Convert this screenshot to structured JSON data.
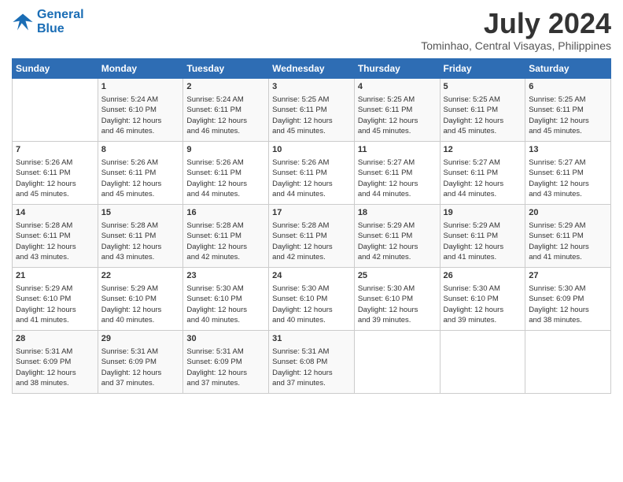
{
  "logo": {
    "line1": "General",
    "line2": "Blue"
  },
  "title": "July 2024",
  "location": "Tominhao, Central Visayas, Philippines",
  "days_header": [
    "Sunday",
    "Monday",
    "Tuesday",
    "Wednesday",
    "Thursday",
    "Friday",
    "Saturday"
  ],
  "weeks": [
    [
      {
        "day": "",
        "lines": []
      },
      {
        "day": "1",
        "lines": [
          "Sunrise: 5:24 AM",
          "Sunset: 6:10 PM",
          "Daylight: 12 hours",
          "and 46 minutes."
        ]
      },
      {
        "day": "2",
        "lines": [
          "Sunrise: 5:24 AM",
          "Sunset: 6:11 PM",
          "Daylight: 12 hours",
          "and 46 minutes."
        ]
      },
      {
        "day": "3",
        "lines": [
          "Sunrise: 5:25 AM",
          "Sunset: 6:11 PM",
          "Daylight: 12 hours",
          "and 45 minutes."
        ]
      },
      {
        "day": "4",
        "lines": [
          "Sunrise: 5:25 AM",
          "Sunset: 6:11 PM",
          "Daylight: 12 hours",
          "and 45 minutes."
        ]
      },
      {
        "day": "5",
        "lines": [
          "Sunrise: 5:25 AM",
          "Sunset: 6:11 PM",
          "Daylight: 12 hours",
          "and 45 minutes."
        ]
      },
      {
        "day": "6",
        "lines": [
          "Sunrise: 5:25 AM",
          "Sunset: 6:11 PM",
          "Daylight: 12 hours",
          "and 45 minutes."
        ]
      }
    ],
    [
      {
        "day": "7",
        "lines": [
          "Sunrise: 5:26 AM",
          "Sunset: 6:11 PM",
          "Daylight: 12 hours",
          "and 45 minutes."
        ]
      },
      {
        "day": "8",
        "lines": [
          "Sunrise: 5:26 AM",
          "Sunset: 6:11 PM",
          "Daylight: 12 hours",
          "and 45 minutes."
        ]
      },
      {
        "day": "9",
        "lines": [
          "Sunrise: 5:26 AM",
          "Sunset: 6:11 PM",
          "Daylight: 12 hours",
          "and 44 minutes."
        ]
      },
      {
        "day": "10",
        "lines": [
          "Sunrise: 5:26 AM",
          "Sunset: 6:11 PM",
          "Daylight: 12 hours",
          "and 44 minutes."
        ]
      },
      {
        "day": "11",
        "lines": [
          "Sunrise: 5:27 AM",
          "Sunset: 6:11 PM",
          "Daylight: 12 hours",
          "and 44 minutes."
        ]
      },
      {
        "day": "12",
        "lines": [
          "Sunrise: 5:27 AM",
          "Sunset: 6:11 PM",
          "Daylight: 12 hours",
          "and 44 minutes."
        ]
      },
      {
        "day": "13",
        "lines": [
          "Sunrise: 5:27 AM",
          "Sunset: 6:11 PM",
          "Daylight: 12 hours",
          "and 43 minutes."
        ]
      }
    ],
    [
      {
        "day": "14",
        "lines": [
          "Sunrise: 5:28 AM",
          "Sunset: 6:11 PM",
          "Daylight: 12 hours",
          "and 43 minutes."
        ]
      },
      {
        "day": "15",
        "lines": [
          "Sunrise: 5:28 AM",
          "Sunset: 6:11 PM",
          "Daylight: 12 hours",
          "and 43 minutes."
        ]
      },
      {
        "day": "16",
        "lines": [
          "Sunrise: 5:28 AM",
          "Sunset: 6:11 PM",
          "Daylight: 12 hours",
          "and 42 minutes."
        ]
      },
      {
        "day": "17",
        "lines": [
          "Sunrise: 5:28 AM",
          "Sunset: 6:11 PM",
          "Daylight: 12 hours",
          "and 42 minutes."
        ]
      },
      {
        "day": "18",
        "lines": [
          "Sunrise: 5:29 AM",
          "Sunset: 6:11 PM",
          "Daylight: 12 hours",
          "and 42 minutes."
        ]
      },
      {
        "day": "19",
        "lines": [
          "Sunrise: 5:29 AM",
          "Sunset: 6:11 PM",
          "Daylight: 12 hours",
          "and 41 minutes."
        ]
      },
      {
        "day": "20",
        "lines": [
          "Sunrise: 5:29 AM",
          "Sunset: 6:11 PM",
          "Daylight: 12 hours",
          "and 41 minutes."
        ]
      }
    ],
    [
      {
        "day": "21",
        "lines": [
          "Sunrise: 5:29 AM",
          "Sunset: 6:10 PM",
          "Daylight: 12 hours",
          "and 41 minutes."
        ]
      },
      {
        "day": "22",
        "lines": [
          "Sunrise: 5:29 AM",
          "Sunset: 6:10 PM",
          "Daylight: 12 hours",
          "and 40 minutes."
        ]
      },
      {
        "day": "23",
        "lines": [
          "Sunrise: 5:30 AM",
          "Sunset: 6:10 PM",
          "Daylight: 12 hours",
          "and 40 minutes."
        ]
      },
      {
        "day": "24",
        "lines": [
          "Sunrise: 5:30 AM",
          "Sunset: 6:10 PM",
          "Daylight: 12 hours",
          "and 40 minutes."
        ]
      },
      {
        "day": "25",
        "lines": [
          "Sunrise: 5:30 AM",
          "Sunset: 6:10 PM",
          "Daylight: 12 hours",
          "and 39 minutes."
        ]
      },
      {
        "day": "26",
        "lines": [
          "Sunrise: 5:30 AM",
          "Sunset: 6:10 PM",
          "Daylight: 12 hours",
          "and 39 minutes."
        ]
      },
      {
        "day": "27",
        "lines": [
          "Sunrise: 5:30 AM",
          "Sunset: 6:09 PM",
          "Daylight: 12 hours",
          "and 38 minutes."
        ]
      }
    ],
    [
      {
        "day": "28",
        "lines": [
          "Sunrise: 5:31 AM",
          "Sunset: 6:09 PM",
          "Daylight: 12 hours",
          "and 38 minutes."
        ]
      },
      {
        "day": "29",
        "lines": [
          "Sunrise: 5:31 AM",
          "Sunset: 6:09 PM",
          "Daylight: 12 hours",
          "and 37 minutes."
        ]
      },
      {
        "day": "30",
        "lines": [
          "Sunrise: 5:31 AM",
          "Sunset: 6:09 PM",
          "Daylight: 12 hours",
          "and 37 minutes."
        ]
      },
      {
        "day": "31",
        "lines": [
          "Sunrise: 5:31 AM",
          "Sunset: 6:08 PM",
          "Daylight: 12 hours",
          "and 37 minutes."
        ]
      },
      {
        "day": "",
        "lines": []
      },
      {
        "day": "",
        "lines": []
      },
      {
        "day": "",
        "lines": []
      }
    ]
  ]
}
